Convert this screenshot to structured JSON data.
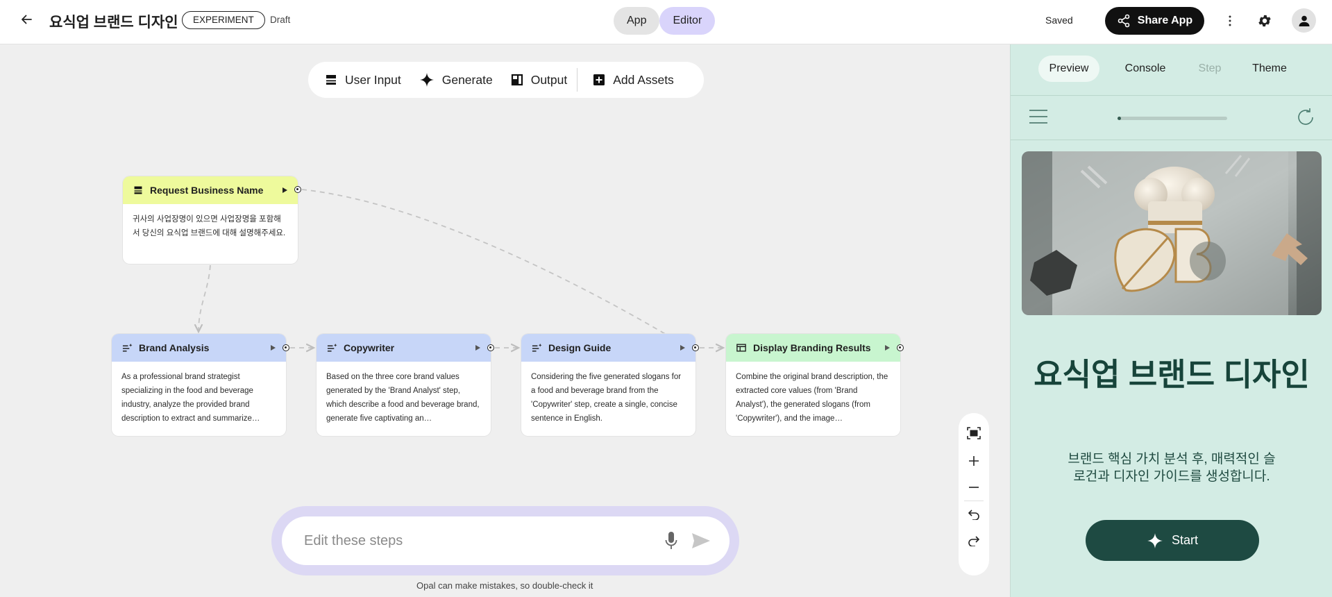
{
  "header": {
    "back_icon": "arrow-left-icon",
    "title": "요식업 브랜드 디자인",
    "badge": "EXPERIMENT",
    "status": "Draft",
    "modes": [
      "App",
      "Editor"
    ],
    "active_mode": "Editor",
    "saved": "Saved",
    "share_label": "Share App",
    "icons": [
      "share-icon",
      "more-vert-icon",
      "gear-icon",
      "account-icon"
    ]
  },
  "toolbar": {
    "items": [
      "User Input",
      "Generate",
      "Output"
    ],
    "add_assets": "Add Assets"
  },
  "nodes": {
    "request": {
      "title": "Request Business Name",
      "body": "귀사의 사업장명이 있으면 사업장명을 포함해서 당신의 요식업 브랜드에 대해 설명해주세요.",
      "type": "user-input",
      "color": "#eefa9c"
    },
    "analysis": {
      "title": "Brand Analysis",
      "body": "As a professional brand strategist specializing in the food and beverage industry, analyze the provided brand description to extract and summarize…",
      "type": "generate",
      "color": "#c7d6f8"
    },
    "copywriter": {
      "title": "Copywriter",
      "body": "Based on the three core brand values generated by the 'Brand Analyst' step, which describe a food and beverage brand, generate five captivating an…",
      "type": "generate",
      "color": "#c7d6f8"
    },
    "design": {
      "title": "Design Guide",
      "body": "Considering the five generated slogans for a food and beverage brand from the 'Copywriter' step, create a single, concise sentence in English.",
      "type": "generate",
      "color": "#c7d6f8"
    },
    "display": {
      "title": "Display Branding Results",
      "body": "Combine the original brand description, the extracted core values (from 'Brand Analyst'), the generated slogans (from 'Copywriter'), and the image…",
      "type": "output",
      "color": "#c8f5cf"
    }
  },
  "zoom_controls": [
    "fit-view-icon",
    "zoom-in-icon",
    "zoom-out-icon",
    "undo-icon",
    "redo-icon"
  ],
  "prompt": {
    "placeholder": "Edit these steps",
    "disclaimer": "Opal can make mistakes, so double-check it"
  },
  "preview": {
    "tabs": [
      "Preview",
      "Console",
      "Step",
      "Theme"
    ],
    "active_tab": "Preview",
    "disabled_tab": "Step",
    "progress": 0.03,
    "heading": "요식업 브랜드 디자인",
    "subtitle": "브랜드 핵심 가치 분석 후, 매력적인 슬로건과 디자인 가이드를 생성합니다.",
    "start_label": "Start"
  },
  "colors": {
    "accent_editor": "#d9d4fb",
    "preview_bg": "#d3ece4",
    "start_button": "#1e4a42",
    "heading": "#17443a"
  }
}
